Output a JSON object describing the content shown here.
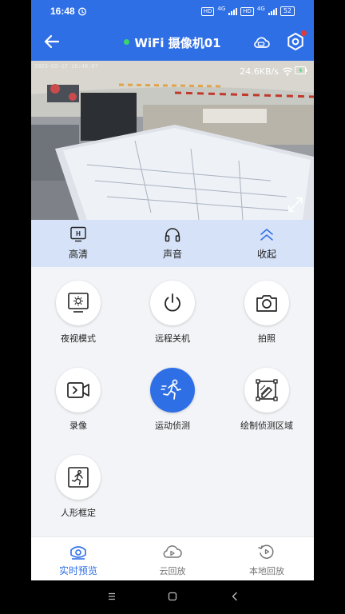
{
  "status": {
    "time": "16:48",
    "hd1": "HD",
    "net1": "4G",
    "hd2": "HD",
    "net2": "4G",
    "battery": "52"
  },
  "header": {
    "title": "WiFi 摄像机01"
  },
  "video": {
    "timestamp": "2023-02-17 16:48:07",
    "speed": "24.6KB/s"
  },
  "quick": [
    {
      "icon": "hd-icon",
      "label": "高清"
    },
    {
      "icon": "headphones-icon",
      "label": "声音"
    },
    {
      "icon": "double-chevron-up-icon",
      "label": "收起"
    }
  ],
  "functions": [
    {
      "icon": "night-vision-icon",
      "label": "夜视模式"
    },
    {
      "icon": "power-icon",
      "label": "远程关机"
    },
    {
      "icon": "camera-icon",
      "label": "拍照"
    },
    {
      "icon": "video-record-icon",
      "label": "录像"
    },
    {
      "icon": "running-person-icon",
      "label": "运动侦测",
      "active": true
    },
    {
      "icon": "draw-area-icon",
      "label": "绘制侦测区域"
    },
    {
      "icon": "person-frame-icon",
      "label": "人形框定"
    }
  ],
  "tabs": [
    {
      "icon": "live-eye-icon",
      "label": "实时预览",
      "active": true
    },
    {
      "icon": "cloud-playback-icon",
      "label": "云回放"
    },
    {
      "icon": "local-playback-icon",
      "label": "本地回放"
    }
  ],
  "colors": {
    "primary": "#2f6fe6",
    "quickbar": "#d6e2f7",
    "online": "#3dd66a",
    "alert": "#e53935"
  }
}
